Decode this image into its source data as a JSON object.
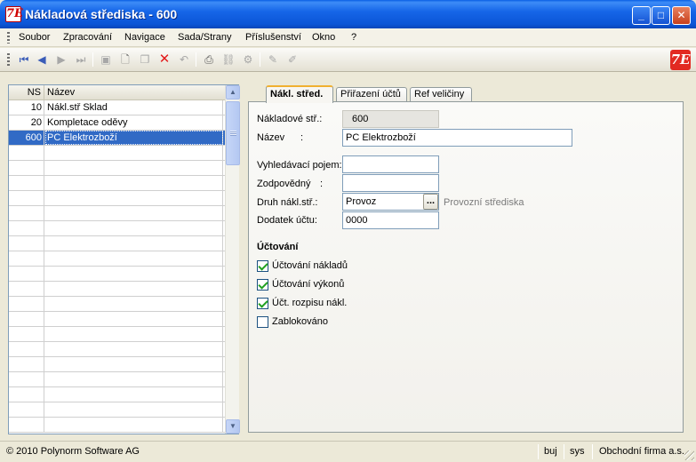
{
  "window": {
    "title": "Nákladová střediska - 600",
    "icon": "app-logo-icon",
    "minimize_label": "_",
    "maximize_label": "□",
    "close_label": "✕"
  },
  "menu": [
    "Soubor",
    "Zpracování",
    "Navigace",
    "Sada/Strany",
    "Příslušenství",
    "Okno",
    "?"
  ],
  "toolbar": {
    "icons": [
      "first-record-icon",
      "previous-record-icon",
      "next-record-icon",
      "last-record-icon",
      "save-icon",
      "new-icon",
      "copy-icon",
      "delete-icon",
      "undo-icon",
      "print-icon",
      "link-icon",
      "settings-icon",
      "edit-icon",
      "edit-alt-icon"
    ],
    "logo_label": "7E"
  },
  "grid": {
    "headers": {
      "ns": "NS",
      "name": "Název"
    },
    "rows": [
      {
        "ns": "10",
        "name": "Nákl.stř Sklad"
      },
      {
        "ns": "20",
        "name": "Kompletace oděvy"
      },
      {
        "ns": "600",
        "name": "PC Elektrozboží"
      }
    ],
    "selected_index": 2
  },
  "tabs": [
    "Nákl. střed.",
    "Přiřazení účtů",
    "Ref veličiny"
  ],
  "form": {
    "ns_label": "Nákladové stř.:",
    "ns_value": "600",
    "name_label": "Název",
    "name_colon": ":",
    "name_value": "PC Elektrozboží",
    "search_label": "Vyhledávací pojem:",
    "search_value": "",
    "responsible_label": "Zodpovědný",
    "responsible_colon": ":",
    "responsible_value": "",
    "type_label": "Druh nákl.stř.:",
    "type_value": "Provoz",
    "type_button": "...",
    "type_hint": "Provozní střediska",
    "suffix_label": "Dodatek účtu:",
    "suffix_value": "0000",
    "accounting_title": "Účtování",
    "checkboxes": [
      {
        "label": "Účtování nákladů",
        "checked": true
      },
      {
        "label": "Účtování výkonů",
        "checked": true
      },
      {
        "label": "Účt. rozpisu nákl.",
        "checked": true
      },
      {
        "label": "Zablokováno",
        "checked": false
      }
    ]
  },
  "status": {
    "copyright": "© 2010 Polynorm Software AG",
    "user": "buj",
    "system": "sys",
    "company": "Obchodní firma a.s."
  }
}
